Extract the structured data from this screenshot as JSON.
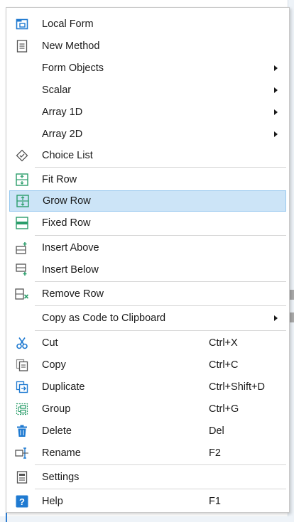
{
  "menu": {
    "items": [
      {
        "label": "Local Form",
        "icon": "local-form-icon"
      },
      {
        "label": "New Method",
        "icon": "new-method-icon"
      },
      {
        "label": "Form Objects",
        "submenu": true
      },
      {
        "label": "Scalar",
        "submenu": true
      },
      {
        "label": "Array 1D",
        "submenu": true
      },
      {
        "label": "Array 2D",
        "submenu": true
      },
      {
        "label": "Choice List",
        "icon": "choice-list-icon"
      },
      {
        "label": "Fit Row",
        "icon": "fit-row-icon"
      },
      {
        "label": "Grow Row",
        "icon": "grow-row-icon",
        "highlighted": true
      },
      {
        "label": "Fixed Row",
        "icon": "fixed-row-icon"
      },
      {
        "label": "Insert Above",
        "icon": "insert-above-icon"
      },
      {
        "label": "Insert Below",
        "icon": "insert-below-icon"
      },
      {
        "label": "Remove Row",
        "icon": "remove-row-icon"
      },
      {
        "label": "Copy as Code to Clipboard",
        "submenu": true
      },
      {
        "label": "Cut",
        "shortcut": "Ctrl+X",
        "icon": "scissors-icon"
      },
      {
        "label": "Copy",
        "shortcut": "Ctrl+C",
        "icon": "copy-icon"
      },
      {
        "label": "Duplicate",
        "shortcut": "Ctrl+Shift+D",
        "icon": "duplicate-icon"
      },
      {
        "label": "Group",
        "shortcut": "Ctrl+G",
        "icon": "group-icon"
      },
      {
        "label": "Delete",
        "shortcut": "Del",
        "icon": "trash-icon"
      },
      {
        "label": "Rename",
        "shortcut": "F2",
        "icon": "rename-icon"
      },
      {
        "label": "Settings",
        "icon": "settings-icon"
      },
      {
        "label": "Help",
        "shortcut": "F1",
        "icon": "help-icon"
      }
    ]
  },
  "colors": {
    "accent": "#1f7ad1",
    "highlight": "#cce4f7",
    "green_icon": "#2a9d6a",
    "gray_icon": "#6b6b6b"
  }
}
